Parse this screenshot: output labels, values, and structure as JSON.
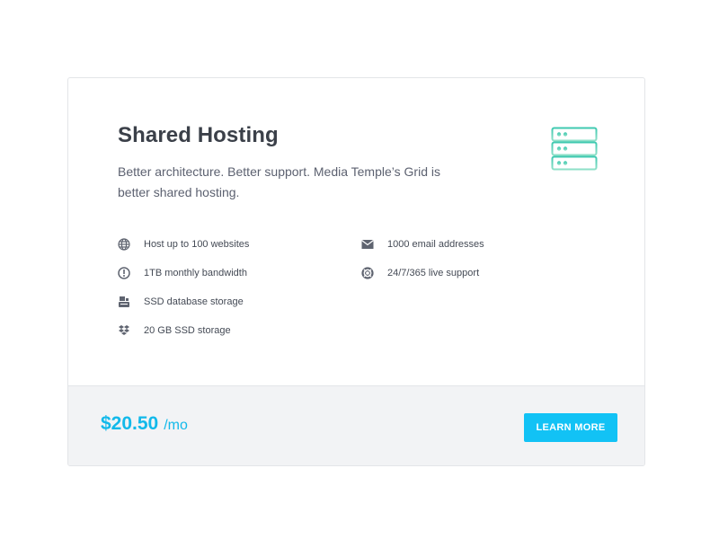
{
  "plan": {
    "title": "Shared Hosting",
    "description": "Better architecture. Better support. Media Temple’s Grid is better shared hosting.",
    "icon": "server-rack-icon"
  },
  "features": [
    {
      "label": "Host up to 100 websites",
      "icon": "globe-icon"
    },
    {
      "label": "1TB monthly bandwidth",
      "icon": "gauge-icon"
    },
    {
      "label": "SSD database storage",
      "icon": "database-icon"
    },
    {
      "label": "20 GB SSD storage",
      "icon": "dropbox-icon"
    },
    {
      "label": "1000 email addresses",
      "icon": "envelope-icon"
    },
    {
      "label": "24/7/365 live support",
      "icon": "lifebuoy-icon"
    }
  ],
  "footer": {
    "price": "$20.50",
    "period": "/mo",
    "button_label": "LEARN MORE"
  },
  "colors": {
    "accent": "#12c2f5",
    "price": "#12b9ea",
    "title": "#3b4049",
    "icon_gradient_start": "#3ec9b0",
    "icon_gradient_end": "#8fe0c8",
    "footer_bg": "#f2f3f5"
  }
}
